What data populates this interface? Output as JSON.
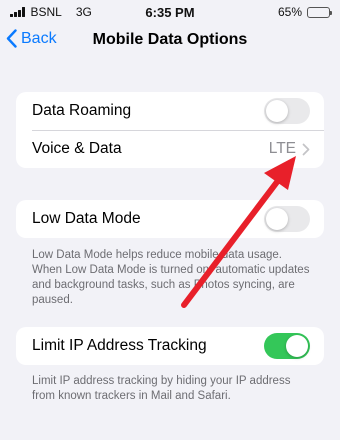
{
  "status_bar": {
    "carrier": "BSNL",
    "network": "3G",
    "time": "6:35 PM",
    "battery": "65%",
    "battery_level": 0.65
  },
  "nav": {
    "back_label": "Back",
    "title": "Mobile Data Options"
  },
  "group1": {
    "data_roaming": {
      "label": "Data Roaming",
      "enabled": false
    },
    "voice_data": {
      "label": "Voice & Data",
      "value": "LTE"
    }
  },
  "group2": {
    "low_data_mode": {
      "label": "Low Data Mode",
      "enabled": false
    },
    "footnote": "Low Data Mode helps reduce mobile data usage. When Low Data Mode is turned on, automatic updates and background tasks, such as Photos syncing, are paused."
  },
  "group3": {
    "limit_ip": {
      "label": "Limit IP Address Tracking",
      "enabled": true
    },
    "footnote": "Limit IP address tracking by hiding your IP address from known trackers in Mail and Safari."
  },
  "colors": {
    "accent": "#0a7aff",
    "toggle_on": "#34c759",
    "annotation_arrow": "#e8202a"
  }
}
